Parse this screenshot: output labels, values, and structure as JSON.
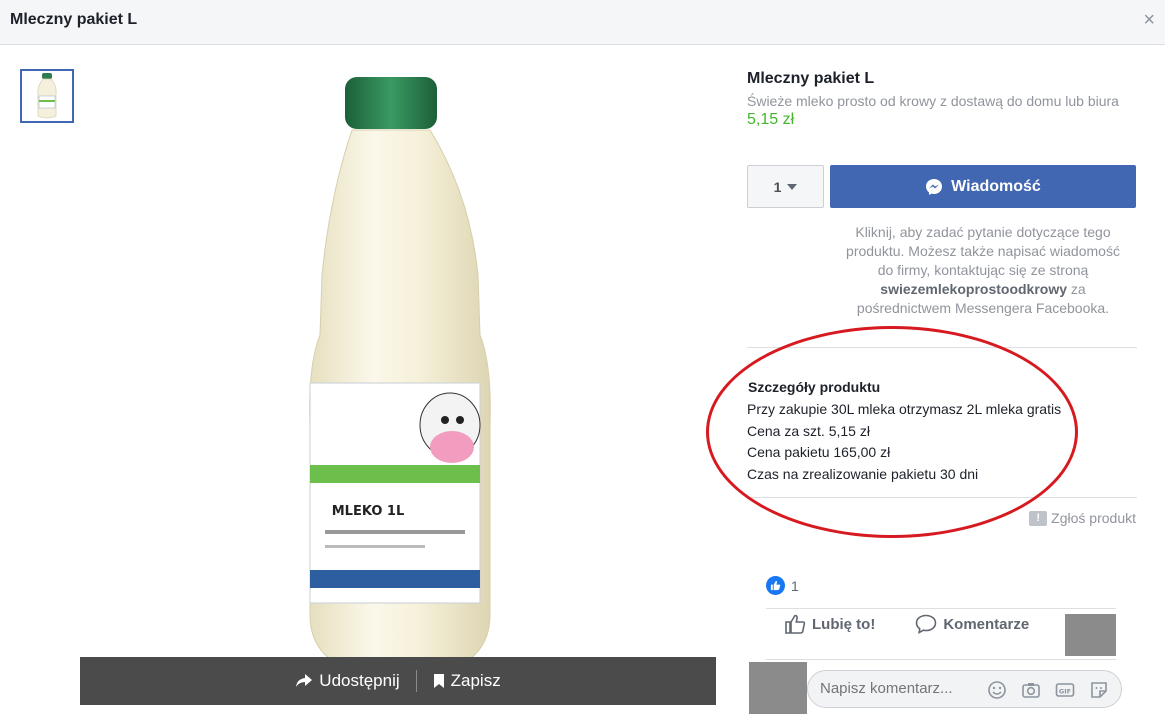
{
  "header": {
    "title": "Mleczny pakiet L",
    "close_label": "×"
  },
  "image_actions": {
    "share_label": "Udostępnij",
    "save_label": "Zapisz"
  },
  "product": {
    "title": "Mleczny pakiet L",
    "description": "Świeże mleko prosto od krowy z dostawą do domu lub biura",
    "price": "5,15 zł",
    "quantity": "1",
    "message_button": "Wiadomość",
    "help_text_part1": "Kliknij, aby zadać pytanie dotyczące tego produktu. Możesz także napisać wiadomość do firmy, kontaktując się ze stroną ",
    "help_text_page": "swiezemlekoprostoodkrowy",
    "help_text_part2": " za pośrednictwem Messengera Facebooka."
  },
  "details": {
    "title": "Szczegóły produktu",
    "lines": [
      "Przy zakupie 30L mleka otrzymasz 2L mleka gratis",
      "Cena za szt. 5,15 zł",
      "Cena pakietu 165,00 zł",
      "Czas na zrealizowanie pakietu 30 dni"
    ]
  },
  "report_label": "Zgłoś produkt",
  "social": {
    "like_count": "1",
    "like_label": "Lubię to!",
    "comment_label": "Komentarze",
    "comment_placeholder": "Napisz komentarz..."
  },
  "colors": {
    "brand": "#4267b2",
    "price": "#42b72a",
    "highlight": "#d71920"
  },
  "icons": [
    "close-icon",
    "share-icon",
    "bookmark-icon",
    "messenger-icon",
    "caret-down-icon",
    "report-icon",
    "like-icon",
    "comment-icon",
    "emoji-icon",
    "camera-icon",
    "gif-icon",
    "sticker-icon"
  ]
}
